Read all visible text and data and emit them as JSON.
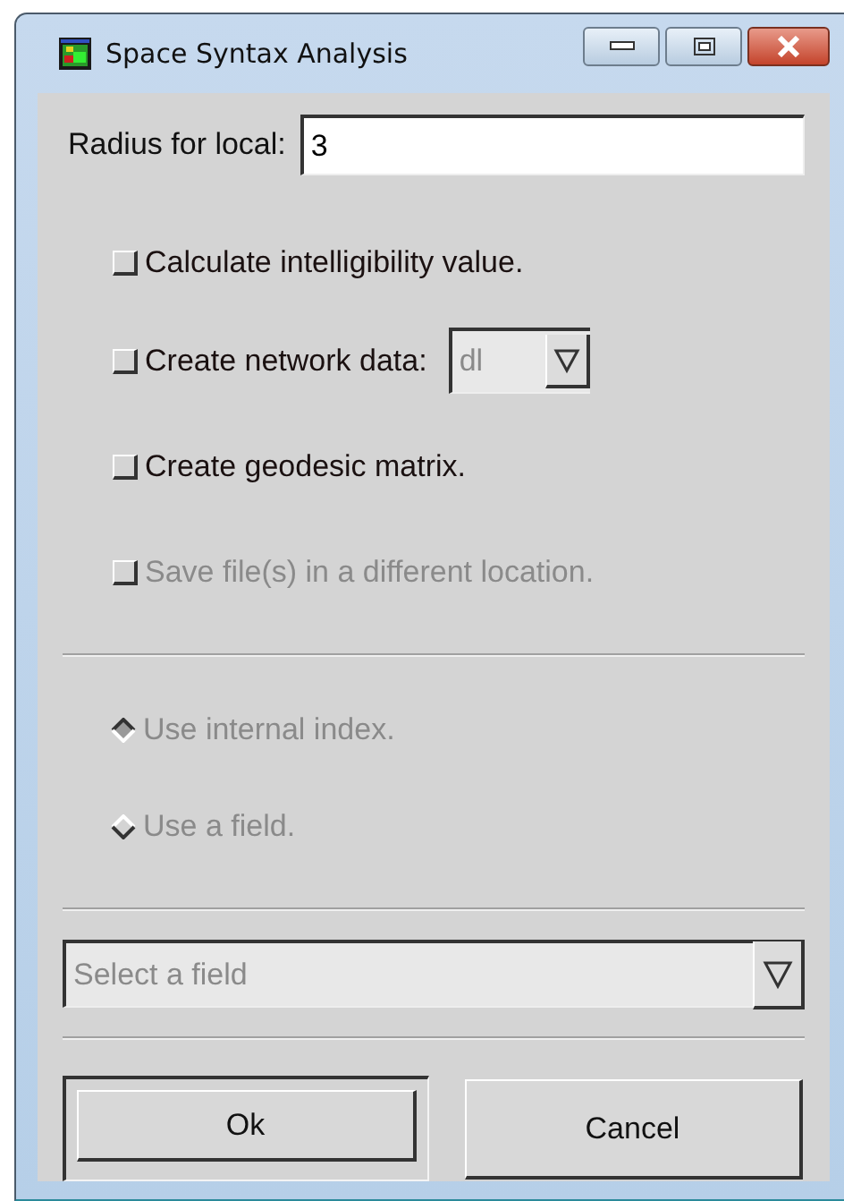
{
  "window": {
    "title": "Space Syntax Analysis"
  },
  "radius": {
    "label": "Radius for local:",
    "value": "3"
  },
  "options": [
    {
      "kind": "checkbox",
      "label": "Calculate intelligibility value.",
      "checked": false,
      "disabled": false
    },
    {
      "kind": "checkbox-select",
      "label": "Create network data:",
      "checked": false,
      "disabled": false,
      "select": {
        "value": "dl",
        "disabled": true
      }
    },
    {
      "kind": "checkbox",
      "label": "Create geodesic matrix.",
      "checked": false,
      "disabled": false
    },
    {
      "kind": "checkbox",
      "label": "Save file(s) in a different location.",
      "checked": false,
      "disabled": true
    }
  ],
  "radios": [
    {
      "label": "Use internal index.",
      "selected": true,
      "disabled": true
    },
    {
      "label": "Use a field.",
      "selected": false,
      "disabled": true
    }
  ],
  "field_select": {
    "placeholder": "Select a field",
    "disabled": true
  },
  "buttons": [
    {
      "label": "Ok",
      "default": true
    },
    {
      "label": "Cancel",
      "default": false
    }
  ]
}
